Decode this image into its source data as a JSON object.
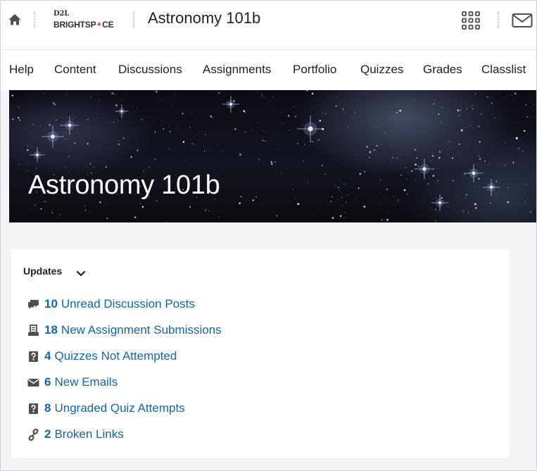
{
  "logo": {
    "line1": "D2L",
    "line2_pre": "BRIGHTSP",
    "line2_dot": "▲",
    "line2_post": "CE"
  },
  "header": {
    "course_title": "Astronomy 101b"
  },
  "nav": {
    "items": [
      "Help",
      "Content",
      "Discussions",
      "Assignments",
      "Portfolio",
      "Quizzes",
      "Grades",
      "Classlist"
    ]
  },
  "banner": {
    "title": "Astronomy 101b"
  },
  "updates": {
    "heading": "Updates",
    "items": [
      {
        "icon": "discussion-icon",
        "count": "10",
        "label": "Unread Discussion Posts"
      },
      {
        "icon": "assignment-icon",
        "count": "18",
        "label": "New Assignment Submissions"
      },
      {
        "icon": "quiz-icon",
        "count": "4",
        "label": "Quizzes Not Attempted"
      },
      {
        "icon": "email-icon",
        "count": "6",
        "label": "New Emails"
      },
      {
        "icon": "quiz-icon",
        "count": "8",
        "label": "Ungraded Quiz Attempts"
      },
      {
        "icon": "link-icon",
        "count": "2",
        "label": "Broken Links"
      }
    ]
  },
  "colors": {
    "link": "#1066b3",
    "text": "#202122",
    "page_bg": "#f3f4f6",
    "accent_logo": "#e1463e"
  }
}
